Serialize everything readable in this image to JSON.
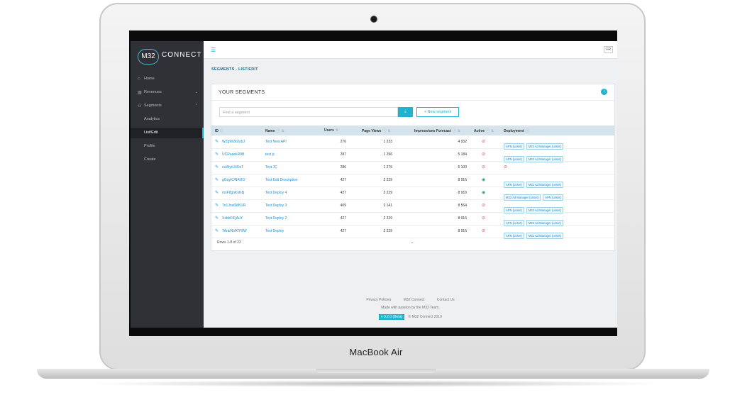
{
  "device": {
    "brand": "MacBook Air"
  },
  "app": {
    "logo_m32": "M32",
    "logo_connect": "CONNECT",
    "language": "FR"
  },
  "sidebar": {
    "items": [
      {
        "label": "Home",
        "icon": "home-icon"
      },
      {
        "label": "Revenues",
        "icon": "chart-icon"
      },
      {
        "label": "Segments",
        "icon": "users-icon"
      },
      {
        "label": "Analytics"
      },
      {
        "label": "List/Edit"
      },
      {
        "label": "Profile"
      },
      {
        "label": "Create"
      }
    ]
  },
  "breadcrumb": "SEGMENTS - LIST/EDIT",
  "card": {
    "title": "YOUR SEGMENTS",
    "search_placeholder": "Find a segment",
    "new_button": "+ New segment"
  },
  "table": {
    "columns": [
      "ID",
      "Name",
      "Users",
      "Page Views",
      "Impressions Forecast",
      "Active",
      "Deployment"
    ],
    "rows": [
      {
        "id": "WZgW2kUsbJ",
        "name": "Test New API",
        "users": "276",
        "page_views": "1 233",
        "forecast": "4 932",
        "active": false,
        "deployment": [
          "APN (unset)",
          "M32 Ad Manager (unset)"
        ]
      },
      {
        "id": "UCRaaekR9B",
        "name": "test jc",
        "users": "287",
        "page_views": "1 296",
        "forecast": "5 184",
        "active": false,
        "deployment": [
          "APN (unset)",
          "M32 Ad Manager (unset)"
        ]
      },
      {
        "id": "ouWyrLNOsT",
        "name": "Test JC",
        "users": "286",
        "page_views": "1 275",
        "forecast": "5 100",
        "active": false,
        "deployment": []
      },
      {
        "id": "gGqyKJNAUG",
        "name": "Test Edit Description",
        "users": "427",
        "page_views": "2 229",
        "forecast": "8 916",
        "active": true,
        "deployment": [
          "APN (unset)",
          "M32 Ad Manager (unset)"
        ]
      },
      {
        "id": "mxF8gnKoK8j",
        "name": "Test Deploy 4",
        "users": "427",
        "page_views": "2 229",
        "forecast": "8 916",
        "active": true,
        "deployment": [
          "M32 Ad Manager (unset)",
          "APN (unset)"
        ]
      },
      {
        "id": "7n1Jnx6MKUR",
        "name": "Test Deploy 3",
        "users": "409",
        "page_views": "2 141",
        "forecast": "8 564",
        "active": false,
        "deployment": [
          "APN (unset)",
          "M32 Ad Manager (unset)"
        ]
      },
      {
        "id": "XxbbFiFjAuY",
        "name": "Test Deploy 2",
        "users": "427",
        "page_views": "2 229",
        "forecast": "8 916",
        "active": false,
        "deployment": [
          "APN (unset)",
          "M32 Ad Manager (unset)"
        ]
      },
      {
        "id": "TAnbNVATF8W",
        "name": "Test Deploy",
        "users": "427",
        "page_views": "2 229",
        "forecast": "8 916",
        "active": false,
        "deployment": [
          "APN (unset)",
          "M32 Ad Manager (unset)"
        ]
      }
    ],
    "rows_summary": "Rows 1-8 of 23"
  },
  "footer": {
    "links": [
      "Privacy Policies",
      "M32 Connect",
      "Contact Us"
    ],
    "made_with": "Made with passion by the M32 Team.",
    "version": "v 0.2.0 (Beta)",
    "copyright": "© M32 Connect 2019"
  },
  "colors": {
    "accent": "#1fb3cc",
    "sidebar": "#2f3136",
    "link": "#1b8fd1",
    "inactive": "#e05555",
    "active": "#2aa56b"
  }
}
